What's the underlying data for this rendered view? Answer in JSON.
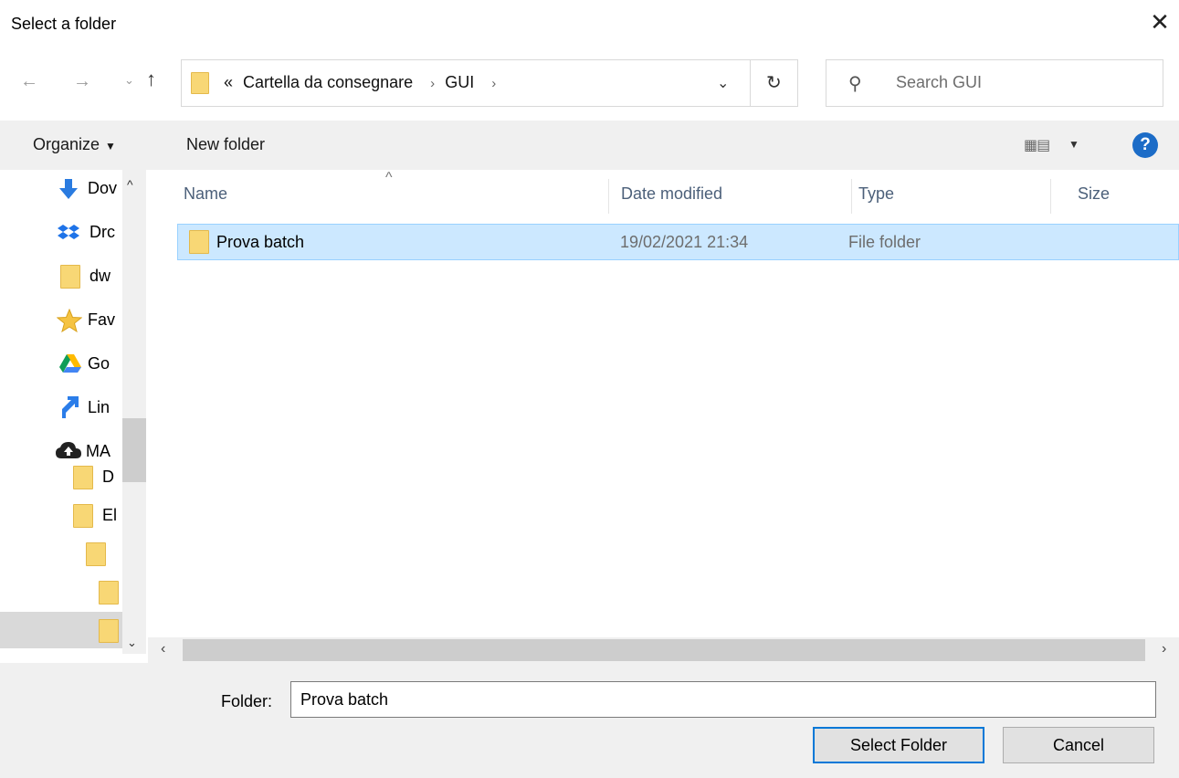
{
  "window": {
    "title": "Select a folder",
    "close": "✕"
  },
  "nav": {
    "back": "←",
    "forward": "→",
    "recent": "⌄",
    "up": "↑"
  },
  "address": {
    "overflow": "«",
    "crumbs": [
      "Cartella da consegnare",
      "GUI"
    ],
    "separator": "›",
    "dropdown": "⌄",
    "refresh": "↻"
  },
  "search": {
    "placeholder": "Search GUI",
    "icon": "search-icon"
  },
  "toolbar": {
    "organize": "Organize",
    "new_folder": "New folder",
    "help": "?"
  },
  "tree": {
    "items": [
      {
        "label": "Dov",
        "icon": "download-arrow-icon"
      },
      {
        "label": "Drc",
        "icon": "dropbox-icon"
      },
      {
        "label": "dw",
        "icon": "folder-icon"
      },
      {
        "label": "Fav",
        "icon": "star-icon"
      },
      {
        "label": "Go",
        "icon": "google-drive-icon"
      },
      {
        "label": "Lin",
        "icon": "link-arrow-icon"
      },
      {
        "label": "MA",
        "icon": "cloud-icon"
      },
      {
        "label": "D",
        "icon": "folder-icon"
      },
      {
        "label": "El",
        "icon": "folder-icon"
      },
      {
        "label": "",
        "icon": "folder-icon"
      },
      {
        "label": "",
        "icon": "folder-icon"
      },
      {
        "label": "",
        "icon": "folder-icon"
      }
    ]
  },
  "list": {
    "columns": {
      "name": "Name",
      "date": "Date modified",
      "type": "Type",
      "size": "Size"
    },
    "rows": [
      {
        "name": "Prova batch",
        "date": "19/02/2021 21:34",
        "type": "File folder",
        "size": ""
      }
    ]
  },
  "footer": {
    "folder_label": "Folder:",
    "folder_value": "Prova batch",
    "select_label": "Select Folder",
    "cancel_label": "Cancel"
  },
  "colors": {
    "selection": "#cce8ff",
    "accent": "#0078d7",
    "folder": "#f8d775",
    "help": "#1c6cc7"
  }
}
